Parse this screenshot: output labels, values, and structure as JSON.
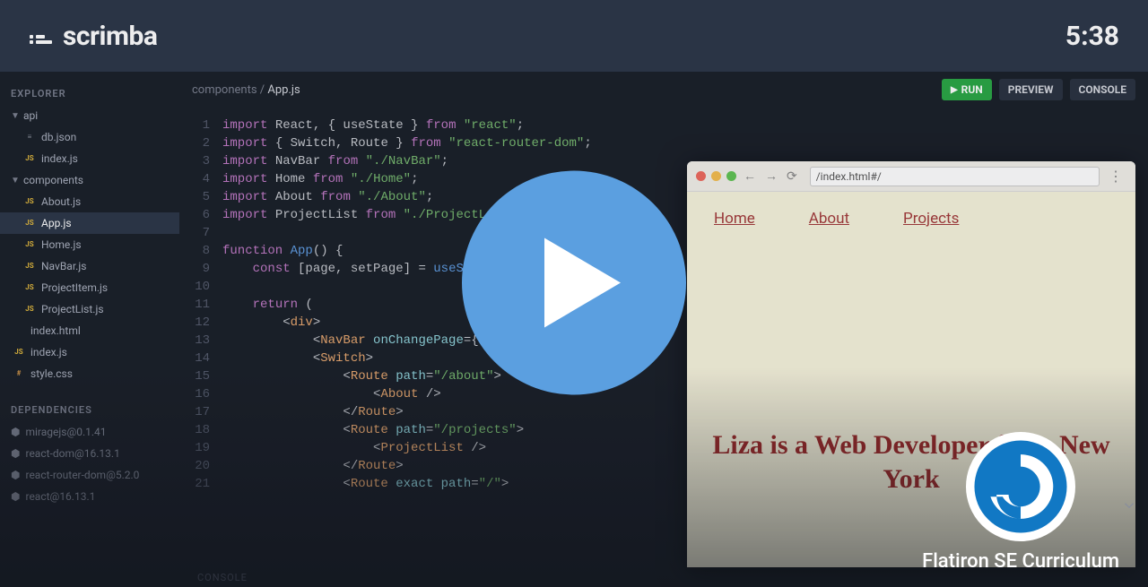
{
  "header": {
    "brand": "scrimba",
    "time": "5:38"
  },
  "sidebar": {
    "explorer_heading": "EXPLORER",
    "folders": [
      {
        "name": "api",
        "items": [
          {
            "badge": "≡",
            "badgeClass": "badge-json",
            "name": "db.json"
          },
          {
            "badge": "JS",
            "badgeClass": "badge-js",
            "name": "index.js"
          }
        ]
      },
      {
        "name": "components",
        "items": [
          {
            "badge": "JS",
            "badgeClass": "badge-js",
            "name": "About.js"
          },
          {
            "badge": "JS",
            "badgeClass": "badge-js",
            "name": "App.js",
            "active": true
          },
          {
            "badge": "JS",
            "badgeClass": "badge-js",
            "name": "Home.js"
          },
          {
            "badge": "JS",
            "badgeClass": "badge-js",
            "name": "NavBar.js"
          },
          {
            "badge": "JS",
            "badgeClass": "badge-js",
            "name": "ProjectItem.js"
          },
          {
            "badge": "JS",
            "badgeClass": "badge-js",
            "name": "ProjectList.js"
          }
        ]
      }
    ],
    "root_files": [
      {
        "badge": "</>",
        "badgeClass": "badge-html",
        "name": "index.html"
      },
      {
        "badge": "JS",
        "badgeClass": "badge-js",
        "name": "index.js"
      },
      {
        "badge": "#",
        "badgeClass": "badge-css",
        "name": "style.css"
      }
    ],
    "deps_heading": "DEPENDENCIES",
    "deps": [
      "miragejs@0.1.41",
      "react-dom@16.13.1",
      "react-router-dom@5.2.0",
      "react@16.13.1"
    ]
  },
  "breadcrumb": {
    "path": "components / ",
    "file": "App.js"
  },
  "actions": {
    "run": "RUN",
    "preview": "PREVIEW",
    "console": "CONSOLE"
  },
  "code": [
    {
      "n": 1,
      "html": "<span class='kw'>import</span> React, { useState } <span class='kw'>from</span> <span class='str'>\"react\"</span>;"
    },
    {
      "n": 2,
      "html": "<span class='kw'>import</span> { Switch, Route } <span class='kw'>from</span> <span class='str'>\"react-router-dom\"</span>;"
    },
    {
      "n": 3,
      "html": "<span class='kw'>import</span> NavBar <span class='kw'>from</span> <span class='str'>\"./NavBar\"</span>;"
    },
    {
      "n": 4,
      "html": "<span class='kw'>import</span> Home <span class='kw'>from</span> <span class='str'>\"./Home\"</span>;"
    },
    {
      "n": 5,
      "html": "<span class='kw'>import</span> About <span class='kw'>from</span> <span class='str'>\"./About\"</span>;"
    },
    {
      "n": 6,
      "html": "<span class='kw'>import</span> ProjectList <span class='kw'>from</span> <span class='str'>\"./ProjectList\"</span>;"
    },
    {
      "n": 7,
      "html": ""
    },
    {
      "n": 8,
      "html": "<span class='kw'>function</span> <span class='fn'>App</span>() {"
    },
    {
      "n": 9,
      "html": "    <span class='kw'>const</span> [page, setPage] = <span class='fn'>useState</span>(<span class='str'>\"/\"</span>)"
    },
    {
      "n": 10,
      "html": ""
    },
    {
      "n": 11,
      "html": "    <span class='kw'>return</span> ("
    },
    {
      "n": 12,
      "html": "        &lt;<span class='tag'>div</span>&gt;"
    },
    {
      "n": 13,
      "html": "            &lt;<span class='tag'>NavBar</span> <span class='op'>onChangePage</span>={setPage} /&gt;"
    },
    {
      "n": 14,
      "html": "            &lt;<span class='tag'>Switch</span>&gt;"
    },
    {
      "n": 15,
      "html": "                &lt;<span class='tag'>Route</span> <span class='op'>path</span>=<span class='str'>\"/about\"</span>&gt;"
    },
    {
      "n": 16,
      "html": "                    &lt;<span class='tag'>About</span> /&gt;"
    },
    {
      "n": 17,
      "html": "                &lt;/<span class='tag'>Route</span>&gt;"
    },
    {
      "n": 18,
      "html": "                &lt;<span class='tag'>Route</span> <span class='op'>path</span>=<span class='str'>\"/projects\"</span>&gt;"
    },
    {
      "n": 19,
      "html": "                    &lt;<span class='tag'>ProjectList</span> /&gt;"
    },
    {
      "n": 20,
      "html": "                &lt;/<span class='tag'>Route</span>&gt;"
    },
    {
      "n": 21,
      "html": "                &lt;<span class='tag'>Route</span> <span class='op'>exact path</span>=<span class='str'>\"/\"</span>&gt;"
    }
  ],
  "console_label": "CONSOLE",
  "preview": {
    "url": "/index.html#/",
    "nav": [
      "Home",
      "About",
      "Projects"
    ],
    "hero": "Liza is a Web Developer from New York"
  },
  "presenter": {
    "name": "Flatiron SE Curriculum"
  }
}
